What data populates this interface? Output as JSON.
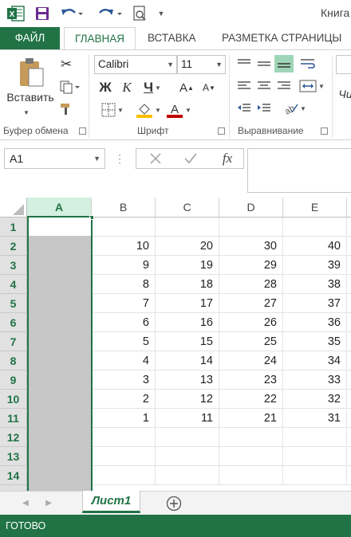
{
  "window": {
    "title": "Книга"
  },
  "tabs": [
    {
      "label": "ФАЙЛ"
    },
    {
      "label": "ГЛАВНАЯ"
    },
    {
      "label": "ВСТАВКА"
    },
    {
      "label": "РАЗМЕТКА СТРАНИЦЫ"
    }
  ],
  "ribbon": {
    "clipboard": {
      "paste_label": "Вставить",
      "group_label": "Буфер обмена"
    },
    "font": {
      "name": "Calibri",
      "size": "11",
      "group_label": "Шрифт",
      "fill_color": "#ffc000",
      "font_color": "#c00000"
    },
    "alignment": {
      "group_label": "Выравнивание"
    },
    "number": {
      "partial_label": "Чи"
    }
  },
  "formula_bar": {
    "name_box": "A1",
    "fx_label": "fx",
    "value": ""
  },
  "grid": {
    "columns": [
      "A",
      "B",
      "C",
      "D",
      "E"
    ],
    "rows": [
      {
        "num": "1",
        "b": "",
        "c": "",
        "d": "",
        "e": ""
      },
      {
        "num": "2",
        "b": "10",
        "c": "20",
        "d": "30",
        "e": "40"
      },
      {
        "num": "3",
        "b": "9",
        "c": "19",
        "d": "29",
        "e": "39"
      },
      {
        "num": "4",
        "b": "8",
        "c": "18",
        "d": "28",
        "e": "38"
      },
      {
        "num": "5",
        "b": "7",
        "c": "17",
        "d": "27",
        "e": "37"
      },
      {
        "num": "6",
        "b": "6",
        "c": "16",
        "d": "26",
        "e": "36"
      },
      {
        "num": "7",
        "b": "5",
        "c": "15",
        "d": "25",
        "e": "35"
      },
      {
        "num": "8",
        "b": "4",
        "c": "14",
        "d": "24",
        "e": "34"
      },
      {
        "num": "9",
        "b": "3",
        "c": "13",
        "d": "23",
        "e": "33"
      },
      {
        "num": "10",
        "b": "2",
        "c": "12",
        "d": "22",
        "e": "32"
      },
      {
        "num": "11",
        "b": "1",
        "c": "11",
        "d": "21",
        "e": "31"
      },
      {
        "num": "12",
        "b": "",
        "c": "",
        "d": "",
        "e": ""
      },
      {
        "num": "13",
        "b": "",
        "c": "",
        "d": "",
        "e": ""
      },
      {
        "num": "14",
        "b": "",
        "c": "",
        "d": "",
        "e": ""
      }
    ]
  },
  "sheets": [
    {
      "label": "Лист1"
    }
  ],
  "status": {
    "text": "ГОТОВО"
  },
  "colors": {
    "accent": "#217346",
    "selection_fill": "#c6c6c6",
    "header_selected": "#d3f0e0"
  }
}
